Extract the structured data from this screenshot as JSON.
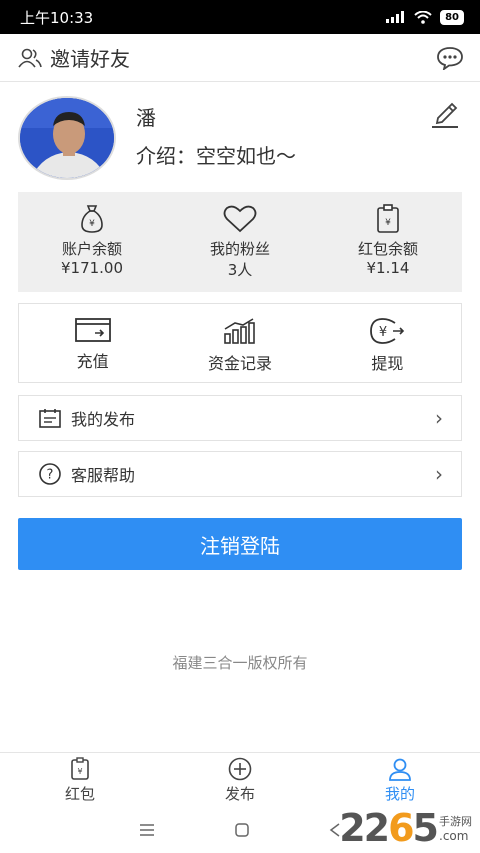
{
  "status": {
    "time": "上午10:33",
    "battery": "80"
  },
  "header": {
    "title": "邀请好友"
  },
  "profile": {
    "name": "潘",
    "intro": "介绍：空空如也～"
  },
  "stats": [
    {
      "label": "账户余额",
      "value": "¥171.00"
    },
    {
      "label": "我的粉丝",
      "value": "3人"
    },
    {
      "label": "红包余额",
      "value": "¥1.14"
    }
  ],
  "actions": [
    {
      "label": "充值"
    },
    {
      "label": "资金记录"
    },
    {
      "label": "提现"
    }
  ],
  "menu": {
    "my_posts": "我的发布",
    "support": "客服帮助"
  },
  "logout_label": "注销登陆",
  "copyright": "福建三合一版权所有",
  "tabs": [
    {
      "label": "红包"
    },
    {
      "label": "发布"
    },
    {
      "label": "我的"
    }
  ],
  "watermark": {
    "big1": "22",
    "big2": "6",
    "big3": "5",
    "small": ".com",
    "small_top": "手游网"
  },
  "colors": {
    "accent": "#2f8ef3",
    "watermark_orange": "#f29b1d"
  }
}
